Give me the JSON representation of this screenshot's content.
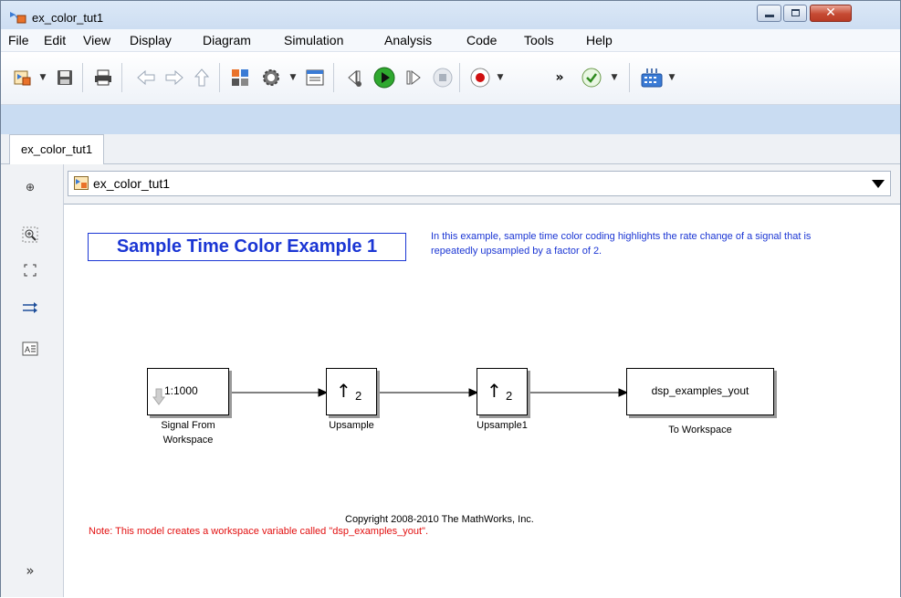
{
  "window": {
    "title": "ex_color_tut1",
    "minimize_glyph": "",
    "maximize_glyph": "",
    "close_glyph": "✕"
  },
  "menu": [
    "File",
    "Edit",
    "View",
    "Display",
    "Diagram",
    "Simulation",
    "Analysis",
    "Code",
    "Tools",
    "Help"
  ],
  "toolbar": {
    "icons": [
      "new-model-icon",
      "save-icon",
      "print-icon",
      "back-icon",
      "forward-icon",
      "up-icon",
      "library-browser-icon",
      "model-config-icon",
      "model-explorer-icon",
      "step-back-icon",
      "run-icon",
      "step-forward-icon",
      "stop-icon",
      "record-icon",
      "more-icon",
      "check-icon",
      "build-icon"
    ],
    "more_glyph": "»"
  },
  "tab": {
    "label": "ex_color_tut1"
  },
  "address": {
    "path": "ex_color_tut1"
  },
  "left_toolbar": {
    "icons": [
      "hide-browser-icon",
      "zoom-icon",
      "fit-to-view-icon",
      "signal-routing-icon",
      "annotation-icon",
      "expand-icon"
    ],
    "expand_glyph": "»"
  },
  "diagram": {
    "title": "Sample Time Color Example 1",
    "description": "In this example, sample time color coding highlights the rate change of a signal that is repeatedly upsampled by a factor of 2.",
    "blocks": [
      {
        "content": "1:1000",
        "label_line1": "Signal From",
        "label_line2": "Workspace"
      },
      {
        "content": "↑",
        "sub": "2",
        "label_line1": "Upsample"
      },
      {
        "content": "↑",
        "sub": "2",
        "label_line1": "Upsample1"
      },
      {
        "content": "dsp_examples_yout",
        "label_line1": "To Workspace"
      }
    ],
    "copyright": "Copyright 2008-2010 The MathWorks, Inc.",
    "note": "Note: This model creates a workspace variable called \"dsp_examples_yout\"."
  },
  "colors": {
    "annotation_blue": "#1b36d4",
    "note_red": "#e21010",
    "run_green": "#2fa82f"
  }
}
